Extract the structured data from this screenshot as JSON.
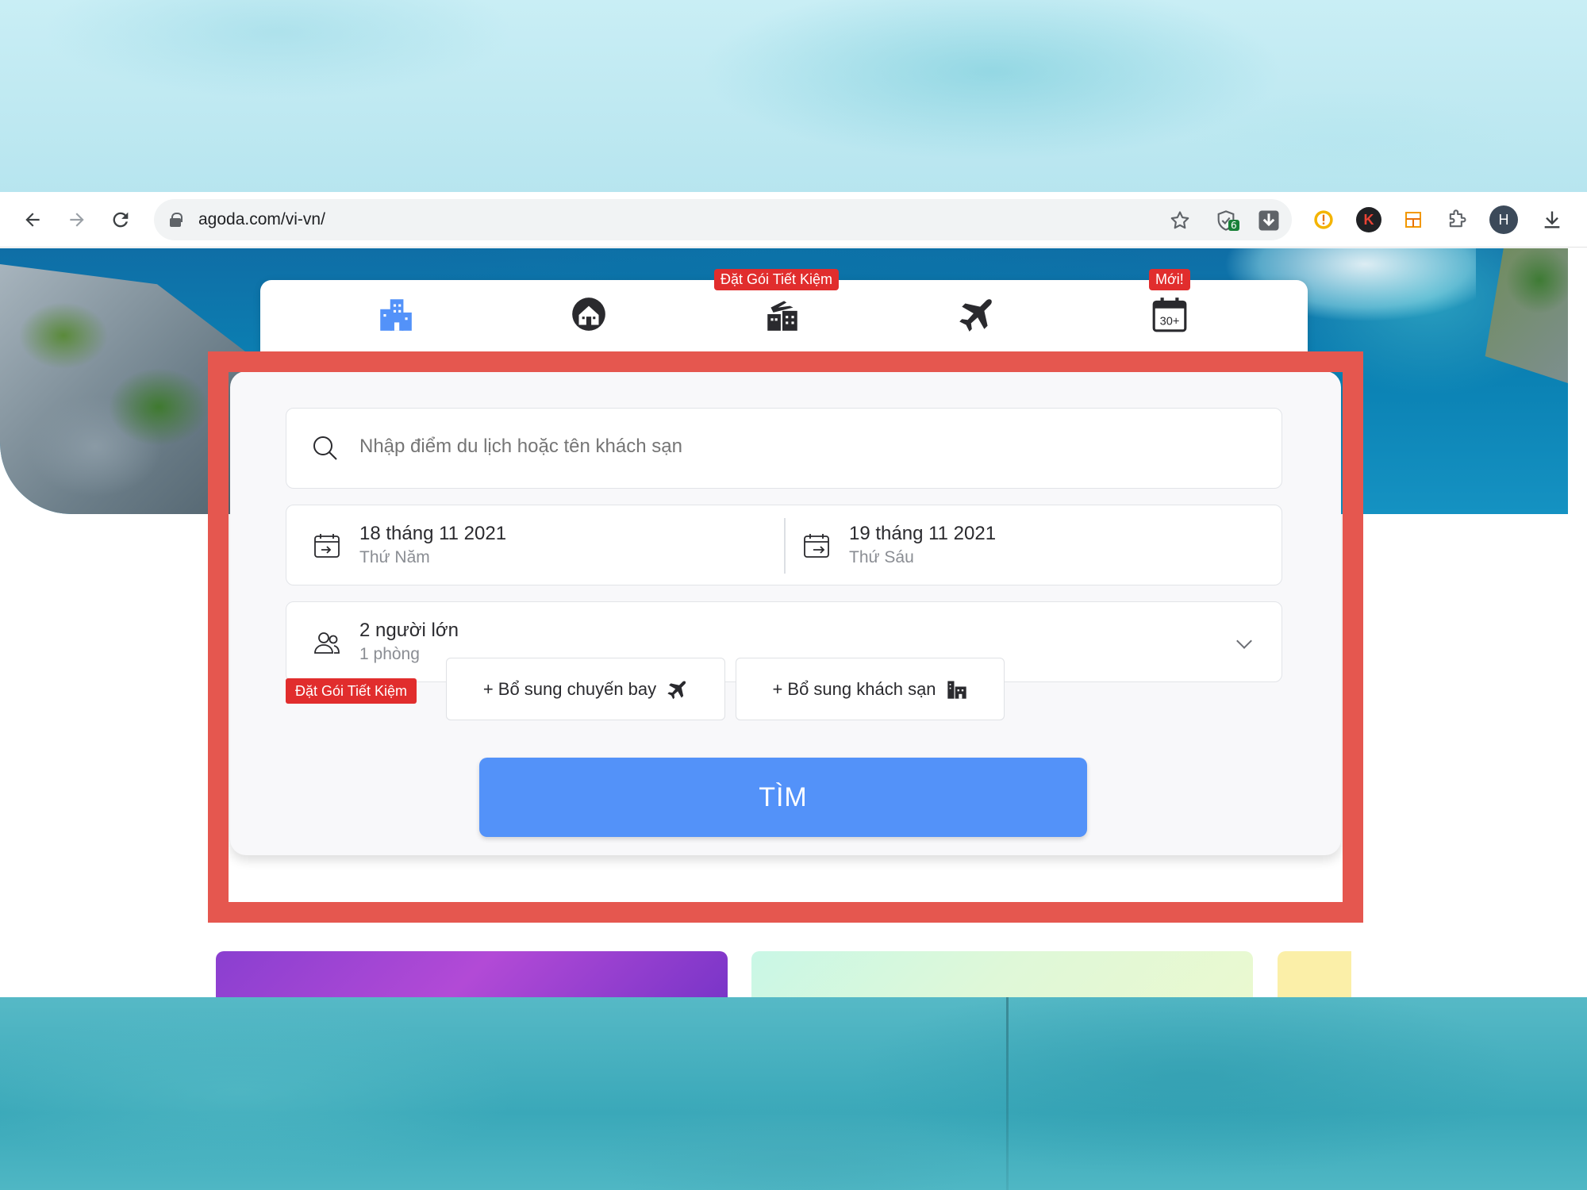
{
  "browser": {
    "url": "agoda.com/vi-vn/",
    "extension_badge_count": "6",
    "profile_initial": "H",
    "extension_k_label": "K"
  },
  "tabs": [
    {
      "icon": "hotel-icon",
      "active": true
    },
    {
      "icon": "home-icon",
      "active": false
    },
    {
      "icon": "flight-hotel-icon",
      "badge": "Đặt Gói Tiết Kiệm"
    },
    {
      "icon": "flight-icon"
    },
    {
      "icon": "calendar-30-icon",
      "badge": "Mới!",
      "icon_text": "30+"
    }
  ],
  "search": {
    "placeholder": "Nhập điểm du lịch hoặc tên khách sạn"
  },
  "checkin": {
    "date": "18 tháng 11 2021",
    "weekday": "Thứ Năm"
  },
  "checkout": {
    "date": "19 tháng 11 2021",
    "weekday": "Thứ Sáu"
  },
  "guests": {
    "adults": "2 người lớn",
    "rooms": "1 phòng"
  },
  "package": {
    "badge": "Đặt Gói Tiết Kiệm",
    "add_flight": "+ Bổ sung chuyến bay",
    "add_hotel": "+ Bổ sung khách sạn"
  },
  "search_button": "TÌM",
  "colors": {
    "accent": "#5392f9",
    "badge_red": "#e12d2d",
    "highlight_frame": "#e5574f"
  }
}
